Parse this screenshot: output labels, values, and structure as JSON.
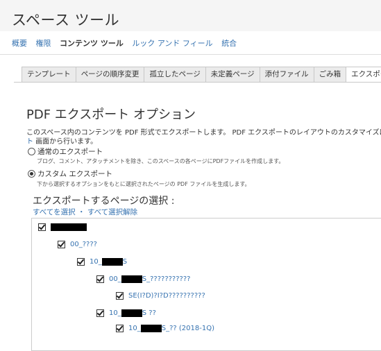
{
  "header": {
    "title": "スペース ツール"
  },
  "nav": [
    {
      "label": "概要",
      "active": false
    },
    {
      "label": "権限",
      "active": false
    },
    {
      "label": "コンテンツ ツール",
      "active": true
    },
    {
      "label": "ルック アンド フィール",
      "active": false
    },
    {
      "label": "統合",
      "active": false
    }
  ],
  "tabs": [
    {
      "label": "テンプレート"
    },
    {
      "label": "ページの順序変更"
    },
    {
      "label": "孤立したページ"
    },
    {
      "label": "未定義ページ"
    },
    {
      "label": "添付ファイル"
    },
    {
      "label": "ごみ箱"
    },
    {
      "label": "エクスポート",
      "active": true
    }
  ],
  "main": {
    "title": "PDF エクスポート オプション",
    "description": "このスペース内のコンテンツを PDF 形式でエクスポートします。 PDF エクスポートのレイアウトのカスタマイズは",
    "description_link": "ト",
    "description_rest": " 画面から行います。",
    "option_normal": {
      "label": "通常のエクスポート",
      "desc": "ブログ、コメント、アタッチメントを除き、このスペースの各ページにPDFファイルを作成します。"
    },
    "option_custom": {
      "label": "カスタム エクスポート",
      "desc": "下から選択するオプションをもとに選択されたページの PDF ファイルを生成します。"
    },
    "selection_title": "エクスポートするページの選択 :",
    "select_all": "すべてを選択",
    "separator": "・",
    "deselect_all": "すべて選択解除"
  },
  "tree": [
    {
      "prefix": "",
      "suffix": ""
    },
    {
      "prefix": "00_????",
      "suffix": ""
    },
    {
      "prefix": "10_",
      "suffix": "S"
    },
    {
      "prefix": "00_",
      "suffix": "S_???????????"
    },
    {
      "prefix": "SE(I?D)?I?D??????????",
      "suffix": ""
    },
    {
      "prefix": "10_",
      "suffix": "S ??"
    },
    {
      "prefix": "10_",
      "suffix": "S_?? (2018-1Q)"
    }
  ]
}
